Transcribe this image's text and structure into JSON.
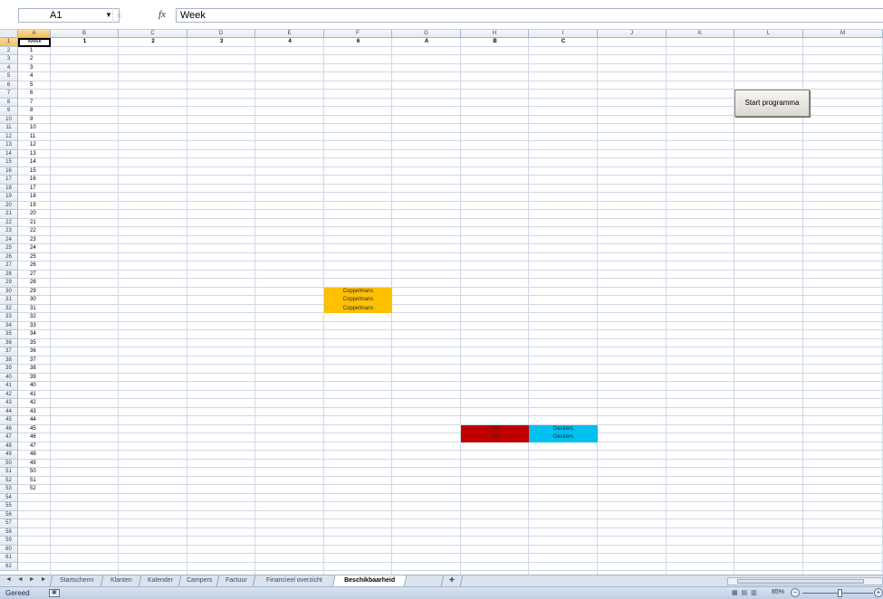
{
  "formula_bar": {
    "name_box": "A1",
    "fx": "fx",
    "formula": "Week"
  },
  "columns": [
    "A",
    "B",
    "C",
    "D",
    "E",
    "F",
    "G",
    "H",
    "I",
    "J",
    "K",
    "L",
    "M"
  ],
  "active_column": "A",
  "active_row": 1,
  "header_row": [
    "Week",
    "1",
    "2",
    "3",
    "4",
    "6",
    "A",
    "B",
    "C"
  ],
  "week_numbers": [
    "1",
    "2",
    "3",
    "4",
    "5",
    "6",
    "7",
    "8",
    "9",
    "10",
    "11",
    "12",
    "13",
    "14",
    "15",
    "16",
    "17",
    "18",
    "19",
    "20",
    "21",
    "22",
    "23",
    "24",
    "25",
    "26",
    "27",
    "28",
    "29",
    "30",
    "31",
    "32",
    "33",
    "34",
    "35",
    "36",
    "37",
    "38",
    "39",
    "40",
    "41",
    "42",
    "43",
    "44",
    "45",
    "46",
    "47",
    "48",
    "49",
    "50",
    "51",
    "52"
  ],
  "highlighted_cells": [
    {
      "row": 30,
      "col": "F",
      "text": "Coppelmans",
      "color": "#ffc000"
    },
    {
      "row": 31,
      "col": "F",
      "text": "Coppelmans",
      "color": "#ffc000"
    },
    {
      "row": 32,
      "col": "F",
      "text": "Coppelmans",
      "color": "#ffc000"
    },
    {
      "row": 46,
      "col": "H",
      "text": "Arts",
      "color": "#c00000"
    },
    {
      "row": 47,
      "col": "H",
      "text": "Arts",
      "color": "#c00000"
    },
    {
      "row": 46,
      "col": "I",
      "text": "Deckers",
      "color": "#00c0f0"
    },
    {
      "row": 47,
      "col": "I",
      "text": "Deckers",
      "color": "#00c0f0"
    }
  ],
  "start_button": "Start programma",
  "sheet_tabs": [
    {
      "label": "Startscherm",
      "active": false
    },
    {
      "label": "Klanten",
      "active": false
    },
    {
      "label": "Kalender",
      "active": false
    },
    {
      "label": "Campers",
      "active": false
    },
    {
      "label": "Factuur",
      "active": false
    },
    {
      "label": "Financieel overzicht",
      "active": false
    },
    {
      "label": "Beschikbaarheid",
      "active": true
    }
  ],
  "status": {
    "ready": "Gereed",
    "zoom": "85%"
  },
  "colors": {
    "header_bg": "#e3e9f1",
    "active_header": "#f1c15f",
    "gridline": "#d0d7e5"
  }
}
